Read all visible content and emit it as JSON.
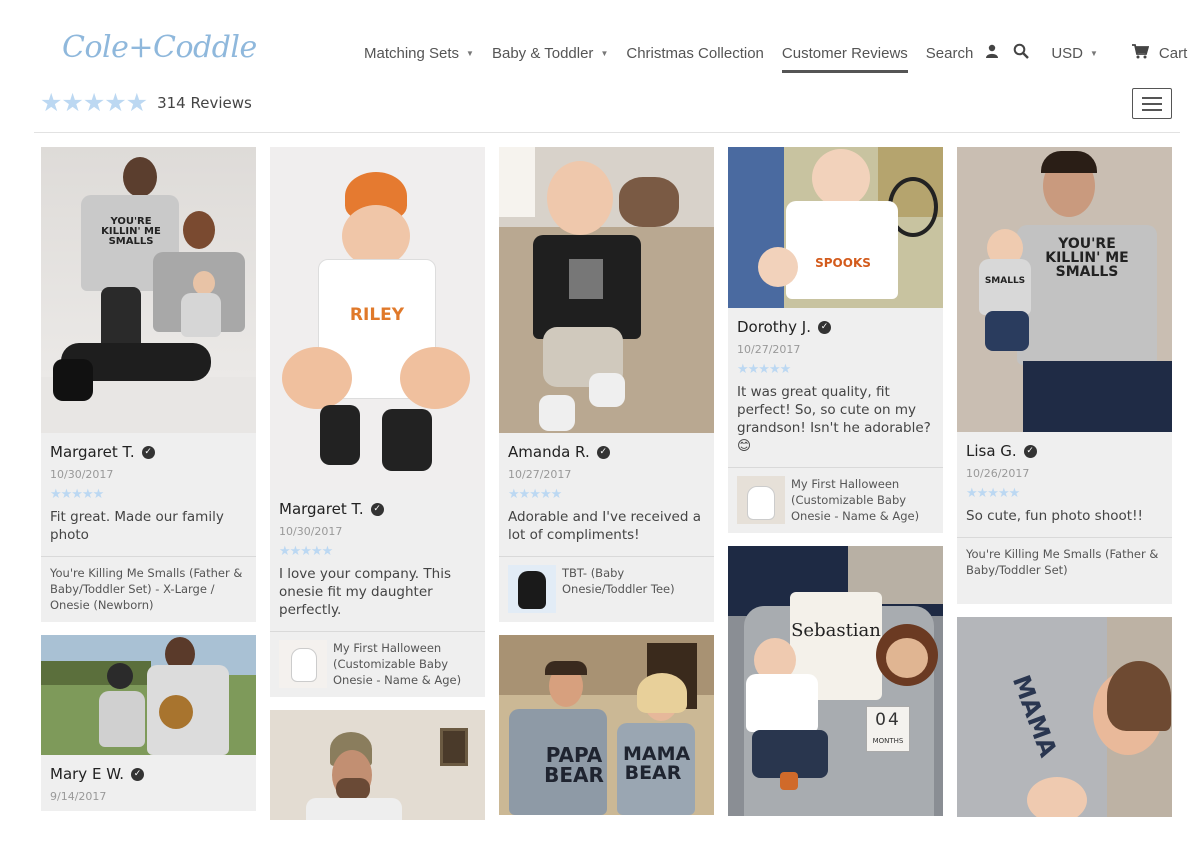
{
  "header": {
    "logo": "Cole+Coddle",
    "nav": {
      "matching_sets": "Matching Sets",
      "baby_toddler": "Baby & Toddler",
      "christmas": "Christmas Collection",
      "customer_reviews": "Customer Reviews",
      "search": "Search",
      "currency": "USD",
      "cart": "Cart"
    }
  },
  "summary": {
    "stars": "★★★★★",
    "count": "314 Reviews"
  },
  "reviews": [
    {
      "name": "Margaret T.",
      "date": "10/30/2017",
      "stars": "★★★★★",
      "text": "Fit great. Made our family photo",
      "product": "You're Killing Me Smalls (Father & Baby/Toddler Set) - X-Large / Onesie (Newborn)",
      "shirt": "YOU'RE KILLIN' ME SMALLS"
    },
    {
      "name": "Mary E W.",
      "date": "9/14/2017"
    },
    {
      "name": "Margaret T.",
      "date": "10/30/2017",
      "stars": "★★★★★",
      "text": "I love your company. This onesie fit my daughter perfectly.",
      "product": "My First Halloween (Customizable Baby Onesie - Name & Age)",
      "shirt": "RILEY"
    },
    {
      "name": "Amanda R.",
      "date": "10/27/2017",
      "stars": "★★★★★",
      "text": "Adorable and I've received a lot of compliments!",
      "product": "TBT- (Baby Onesie/Toddler Tee)"
    },
    {
      "name": "Dorothy J.",
      "date": "10/27/2017",
      "stars": "★★★★★",
      "text": "It was great quality, fit perfect! So, so cute on my grandson! Isn't he adorable?",
      "emoji": "😊",
      "product": "My First Halloween (Customizable Baby Onesie - Name & Age)",
      "shirt": "SPOOKS"
    },
    {
      "name": "Lisa G.",
      "date": "10/26/2017",
      "stars": "★★★★★",
      "text": "So cute, fun photo shoot!!",
      "product": "You're Killing Me Smalls (Father & Baby/Toddler Set)",
      "shirt": "YOU'RE KILLIN' ME SMALLS",
      "shirt_small": "SMALLS"
    }
  ],
  "photos": {
    "papa_bear": "PAPA BEAR",
    "mama_bear": "MAMA BEAR",
    "pillow_name": "Sebastian",
    "months_number": "04",
    "months_label": "MONTHS",
    "mama": "MAMA"
  },
  "colors": {
    "star": "#bcd8f2",
    "logo": "#8fb8dc",
    "card_bg": "#efefef"
  }
}
